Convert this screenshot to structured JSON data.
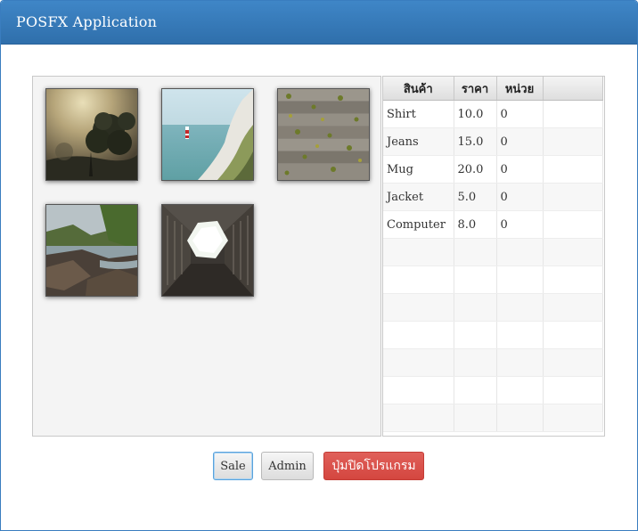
{
  "window": {
    "title": "POSFX Application"
  },
  "products": [
    {
      "name": "fog-tree-photo"
    },
    {
      "name": "lighthouse-cliff-photo"
    },
    {
      "name": "wooden-deck-leaves-photo"
    },
    {
      "name": "river-rocks-photo"
    },
    {
      "name": "building-skylight-photo"
    }
  ],
  "table": {
    "headers": [
      "สินค้า",
      "ราคา",
      "หน่วย",
      ""
    ],
    "rows": [
      [
        "Shirt",
        "10.0",
        "0",
        ""
      ],
      [
        "Jeans",
        "15.0",
        "0",
        ""
      ],
      [
        "Mug",
        "20.0",
        "0",
        ""
      ],
      [
        "Jacket",
        "5.0",
        "0",
        ""
      ],
      [
        "Computer",
        "8.0",
        "0",
        ""
      ],
      [
        "",
        "",
        "",
        ""
      ],
      [
        "",
        "",
        "",
        ""
      ],
      [
        "",
        "",
        "",
        ""
      ],
      [
        "",
        "",
        "",
        ""
      ],
      [
        "",
        "",
        "",
        ""
      ],
      [
        "",
        "",
        "",
        ""
      ],
      [
        "",
        "",
        "",
        ""
      ]
    ]
  },
  "buttons": {
    "sale": "Sale",
    "admin": "Admin",
    "exit": "ปุ่มปิดโปรแกรม"
  },
  "colors": {
    "titlebar": "#3378bd",
    "exit_button": "#d9534f",
    "focus": "#5aa3dc"
  }
}
